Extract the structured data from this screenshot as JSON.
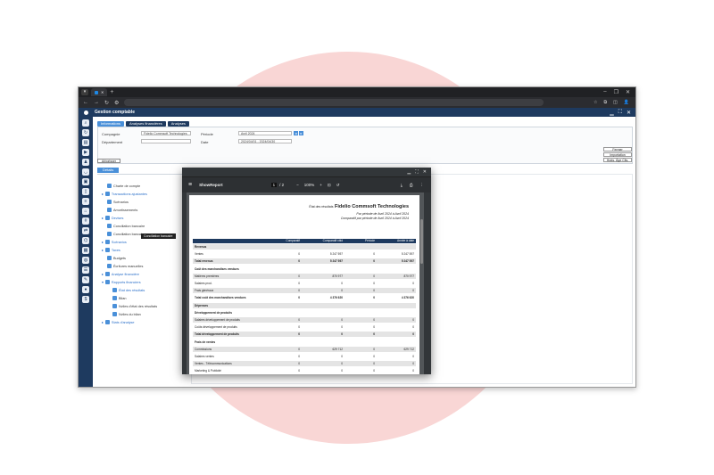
{
  "browser": {
    "new_tab": "+",
    "window_controls": [
      "–",
      "❐",
      "✕"
    ],
    "nav": [
      "←",
      "→",
      "↻",
      "⚙"
    ],
    "url": "",
    "extensions": [
      "☆",
      "⧉",
      "◫",
      "👤"
    ]
  },
  "app": {
    "title": "Gestion comptable",
    "controls": [
      "▁",
      "⛶",
      "✕"
    ]
  },
  "form_tabs": [
    "Informations",
    "Analyses financières",
    "Analyses"
  ],
  "form": {
    "company_label": "Compagnie",
    "company_value": "Fidelio Commsoft Technologies",
    "period_label": "Période",
    "period_value": "Avril 2024",
    "department_label": "Département",
    "department_value": "",
    "date_label": "Date",
    "date_value": "2024/04/01 - 2024/04/30"
  },
  "buttons": {
    "close": "Fermer",
    "import": "Importation",
    "ages": "Hrats. Âge Clts.",
    "tree": "Arborisser"
  },
  "details_tab": "Détails",
  "tree": [
    "Charte de compte",
    "Transactions ajustantes",
    "Scénarios",
    "Amortissements",
    "Devises",
    "Conciliation bancaire",
    "Conciliation bancaire",
    "Scénarios",
    "Taxes",
    "Budgets",
    "Écritures manuelles",
    "Analyse financière",
    "Rapports financiers",
    "État des résultats",
    "Bilan",
    "Nvlles d'état des résultats",
    "Nvlles du bilan",
    "Stats d'analyse"
  ],
  "tooltip": "Conciliation bancaire",
  "pdf": {
    "name": "ShowReport",
    "page": "1",
    "pages": "/ 2",
    "zoom": "100%",
    "window_controls": [
      "▁",
      "⛶",
      "✕"
    ],
    "title": "État des résultats",
    "company": "Fidelio Commsoft Technologies",
    "sub1": "Par période de  Avril 2024 à  Avril 2024",
    "sub2": "Comparatif par période de  Avril 2024 à  Avril 2024",
    "headers": [
      "Comparatif",
      "Comparatif cbld",
      "Période",
      "Année à date"
    ],
    "rows": [
      {
        "n": "Revenus",
        "v": [
          "",
          "",
          "",
          ""
        ],
        "b": true,
        "s": true
      },
      {
        "n": "Ventes",
        "v": [
          "0",
          "5 247 597",
          "0",
          "5 247 597"
        ]
      },
      {
        "n": "Total revenus",
        "v": [
          "0",
          "5 247 597",
          "0",
          "5 247 597"
        ],
        "b": true,
        "s": true
      },
      {
        "n": "Coût des marchandises vendues",
        "v": [
          "",
          "",
          "",
          ""
        ],
        "b": true
      },
      {
        "n": "Matières premières",
        "v": [
          "0",
          "870 977",
          "0",
          "870 977"
        ],
        "s": true
      },
      {
        "n": "Salaires prod.",
        "v": [
          "0",
          "0",
          "0",
          "0"
        ]
      },
      {
        "n": "Frais généraux",
        "v": [
          "0",
          "0",
          "0",
          "0"
        ],
        "s": true
      },
      {
        "n": "Total coût des marchandises vendues",
        "v": [
          "0",
          "4 376 620",
          "0",
          "4 376 620"
        ],
        "b": true
      },
      {
        "n": "Dépenses",
        "v": [
          "",
          "",
          "",
          ""
        ],
        "b": true,
        "s": true
      },
      {
        "n": "Développement de produits",
        "v": [
          "",
          "",
          "",
          ""
        ],
        "b": true
      },
      {
        "n": "Salaires développement de produits",
        "v": [
          "0",
          "0",
          "0",
          "0"
        ],
        "s": true
      },
      {
        "n": "Coûts développement de produits",
        "v": [
          "0",
          "0",
          "0",
          "0"
        ]
      },
      {
        "n": "Total développement de produits",
        "v": [
          "0",
          "0",
          "0",
          "0"
        ],
        "b": true,
        "s": true
      },
      {
        "n": "Frais de ventes",
        "v": [
          "",
          "",
          "",
          ""
        ],
        "b": true
      },
      {
        "n": "Commissions",
        "v": [
          "0",
          "629 712",
          "0",
          "629 712"
        ],
        "s": true
      },
      {
        "n": "Salaires ventes",
        "v": [
          "0",
          "0",
          "0",
          "0"
        ]
      },
      {
        "n": "Ventes - Télécommunications",
        "v": [
          "0",
          "0",
          "0",
          "0"
        ],
        "s": true
      },
      {
        "n": "Marketing & Publicité",
        "v": [
          "0",
          "0",
          "0",
          "0"
        ]
      },
      {
        "n": "Frais de déplacement",
        "v": [
          "0",
          "0",
          "0",
          "0"
        ],
        "s": true
      },
      {
        "n": "Frais d'exposition",
        "v": [
          "0",
          "0",
          "0",
          "0"
        ]
      },
      {
        "n": "Total frais de ventes",
        "v": [
          "0",
          "629 712",
          "0",
          "629 712"
        ],
        "b": true,
        "s": true
      }
    ]
  }
}
